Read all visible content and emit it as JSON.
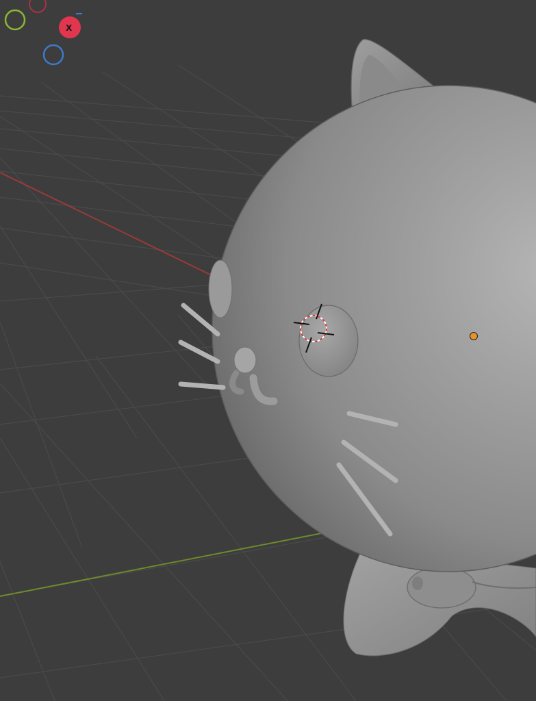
{
  "app": "3D Viewport",
  "gizmo": {
    "x_axis_label": "X",
    "colors": {
      "x": "#e0364f",
      "y": "#8ab833",
      "z": "#3f79c9",
      "x_neg": "#a63246"
    }
  },
  "viewport": {
    "background": "#3d3d3d",
    "grid_color": "#555555",
    "x_axis_color": "#9a3a3a",
    "y_axis_color": "#6d8b2c",
    "object": "cat-mesh",
    "origin_dot_color": "#e6912a"
  }
}
